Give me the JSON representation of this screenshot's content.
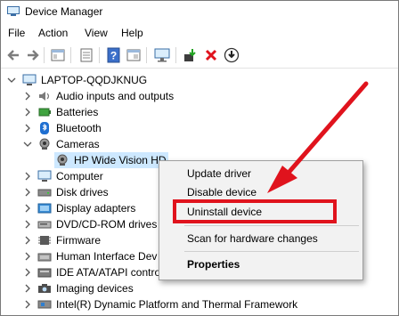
{
  "window": {
    "title": "Device Manager"
  },
  "menu": {
    "items": [
      "File",
      "Action",
      "View",
      "Help"
    ]
  },
  "toolbar": {
    "buttons": [
      "back-icon",
      "forward-icon",
      "show-hide-tree-icon",
      "properties-icon",
      "help-icon",
      "view-icon",
      "scan-hardware-icon",
      "update-driver-icon",
      "uninstall-icon",
      "disable-icon"
    ]
  },
  "tree": {
    "root": "LAPTOP-QQDJKNUG",
    "items": [
      {
        "label": "Audio inputs and outputs",
        "icon": "speaker-icon"
      },
      {
        "label": "Batteries",
        "icon": "battery-icon"
      },
      {
        "label": "Bluetooth",
        "icon": "bluetooth-icon"
      },
      {
        "label": "Cameras",
        "icon": "camera-icon"
      },
      {
        "label": "HP Wide Vision HD",
        "icon": "webcam-icon"
      },
      {
        "label": "Computer",
        "icon": "computer-icon"
      },
      {
        "label": "Disk drives",
        "icon": "disk-icon"
      },
      {
        "label": "Display adapters",
        "icon": "display-adapter-icon"
      },
      {
        "label": "DVD/CD-ROM drives",
        "icon": "dvd-icon"
      },
      {
        "label": "Firmware",
        "icon": "firmware-icon"
      },
      {
        "label": "Human Interface Dev",
        "icon": "hid-icon"
      },
      {
        "label": "IDE ATA/ATAPI contro",
        "icon": "ide-icon"
      },
      {
        "label": "Imaging devices",
        "icon": "imaging-icon"
      },
      {
        "label": "Intel(R) Dynamic Platform and Thermal Framework",
        "icon": "chip-icon"
      }
    ]
  },
  "context_menu": {
    "items": [
      "Update driver",
      "Disable device",
      "Uninstall device",
      "Scan for hardware changes",
      "Properties"
    ]
  },
  "colors": {
    "highlight": "#e0131d",
    "selection": "#cde8ff",
    "bluetooth": "#1f6fd1"
  }
}
